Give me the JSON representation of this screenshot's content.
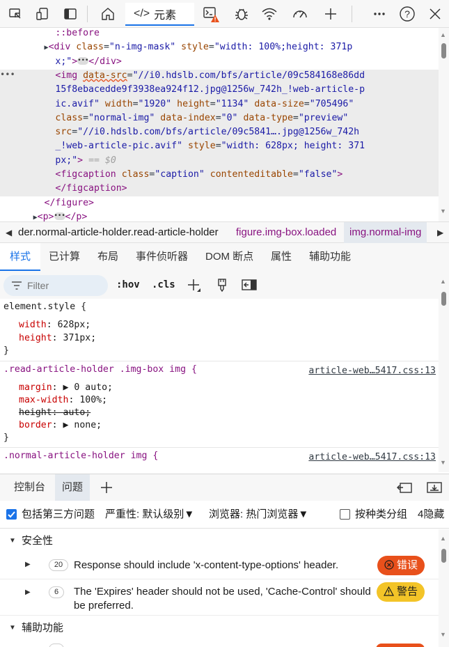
{
  "toolbar": {
    "elements_tab_label": "元素",
    "icons": [
      "inspect-icon",
      "device-emulation-icon",
      "dock-icon",
      "welcome-home-icon",
      "elements-code-icon",
      "console-icon",
      "bug-sources-icon",
      "wifi-network-icon",
      "performance-gauge-icon",
      "add-tool-icon",
      "more-icon",
      "help-icon",
      "close-icon"
    ],
    "warning_color": "#e8501b"
  },
  "dom": {
    "lines": [
      {
        "indent": "          ",
        "parts": [
          {
            "c": "tag",
            "t": "::before"
          }
        ]
      },
      {
        "indent": "         ",
        "caret": "▶",
        "parts": [
          {
            "c": "tag",
            "t": "<div "
          },
          {
            "c": "attr",
            "t": "class"
          },
          {
            "c": "plain",
            "t": "="
          },
          {
            "c": "val",
            "t": "\"n-img-mask\""
          },
          {
            "c": "plain",
            "t": " "
          },
          {
            "c": "attr",
            "t": "style"
          },
          {
            "c": "plain",
            "t": "="
          },
          {
            "c": "val",
            "t": "\"width: 100%;height: 371p"
          }
        ]
      },
      {
        "indent": "          ",
        "parts": [
          {
            "c": "val",
            "t": "x;\""
          },
          {
            "c": "tag",
            "t": ">"
          },
          {
            "c": "ell",
            "t": "•••"
          },
          {
            "c": "tag",
            "t": "</div>"
          }
        ]
      },
      {
        "indent": "          ",
        "parts": [
          {
            "c": "tag",
            "t": "<img "
          },
          {
            "c": "attr",
            "t": "data-src"
          },
          {
            "c": "plain",
            "t": "="
          },
          {
            "c": "val",
            "t": "\"//i0.hdslb.com/bfs/article/09c584168e86dd"
          }
        ]
      },
      {
        "indent": "          ",
        "parts": [
          {
            "c": "val",
            "t": "15f8ebacedde9f3938ea924f12.jpg@1256w_742h_!web-article-p"
          }
        ]
      },
      {
        "indent": "          ",
        "parts": [
          {
            "c": "val",
            "t": "ic.avif\""
          },
          {
            "c": "plain",
            "t": " "
          },
          {
            "c": "attr",
            "t": "width"
          },
          {
            "c": "plain",
            "t": "="
          },
          {
            "c": "val",
            "t": "\"1920\""
          },
          {
            "c": "plain",
            "t": " "
          },
          {
            "c": "attr",
            "t": "height"
          },
          {
            "c": "plain",
            "t": "="
          },
          {
            "c": "val",
            "t": "\"1134\""
          },
          {
            "c": "plain",
            "t": " "
          },
          {
            "c": "attr",
            "t": "data-size"
          },
          {
            "c": "plain",
            "t": "="
          },
          {
            "c": "val",
            "t": "\"705496\""
          }
        ]
      },
      {
        "indent": "          ",
        "parts": [
          {
            "c": "attr",
            "t": "class"
          },
          {
            "c": "plain",
            "t": "="
          },
          {
            "c": "val",
            "t": "\"normal-img\""
          },
          {
            "c": "plain",
            "t": " "
          },
          {
            "c": "attr",
            "t": "data-index"
          },
          {
            "c": "plain",
            "t": "="
          },
          {
            "c": "val",
            "t": "\"0\""
          },
          {
            "c": "plain",
            "t": " "
          },
          {
            "c": "attr",
            "t": "data-type"
          },
          {
            "c": "plain",
            "t": "="
          },
          {
            "c": "val",
            "t": "\"preview\""
          }
        ]
      },
      {
        "indent": "          ",
        "parts": [
          {
            "c": "attr",
            "t": "src"
          },
          {
            "c": "plain",
            "t": "="
          },
          {
            "c": "val",
            "t": "\"//i0.hdslb.com/bfs/article/09c5841….jpg@1256w_742h"
          }
        ]
      },
      {
        "indent": "          ",
        "parts": [
          {
            "c": "val",
            "t": "_!web-article-pic.avif\""
          },
          {
            "c": "plain",
            "t": " "
          },
          {
            "c": "attr",
            "t": "style"
          },
          {
            "c": "plain",
            "t": "="
          },
          {
            "c": "val",
            "t": "\"width: 628px; height: 371"
          }
        ]
      },
      {
        "indent": "          ",
        "parts": [
          {
            "c": "val",
            "t": "px;\""
          },
          {
            "c": "tag",
            "t": ">"
          },
          {
            "c": "dim",
            "t": " == $0"
          }
        ]
      },
      {
        "indent": "          ",
        "parts": [
          {
            "c": "tag",
            "t": "<figcaption "
          },
          {
            "c": "attr",
            "t": "class"
          },
          {
            "c": "plain",
            "t": "="
          },
          {
            "c": "val",
            "t": "\"caption\""
          },
          {
            "c": "plain",
            "t": " "
          },
          {
            "c": "attr",
            "t": "contenteditable"
          },
          {
            "c": "plain",
            "t": "="
          },
          {
            "c": "val",
            "t": "\"false\""
          },
          {
            "c": "tag",
            "t": ">"
          }
        ]
      },
      {
        "indent": "          ",
        "parts": [
          {
            "c": "tag",
            "t": "</figcaption>"
          }
        ]
      },
      {
        "indent": "        ",
        "parts": [
          {
            "c": "tag",
            "t": "</figure>"
          }
        ]
      },
      {
        "indent": "       ",
        "caret": "▶",
        "parts": [
          {
            "c": "tag",
            "t": "<p>"
          },
          {
            "c": "ell",
            "t": "•••"
          },
          {
            "c": "tag",
            "t": "</p>"
          }
        ]
      }
    ],
    "row_menu": "•••"
  },
  "breadcrumb": {
    "items": [
      "der.normal-article-holder.read-article-holder",
      "figure.img-box.loaded",
      "img.normal-img"
    ]
  },
  "panel_tabs": [
    "样式",
    "已计算",
    "布局",
    "事件侦听器",
    "DOM 断点",
    "属性",
    "辅助功能"
  ],
  "styles_toolbar": {
    "filter_placeholder": "Filter",
    "hov": ":hov",
    "cls": ".cls"
  },
  "styles": {
    "element_style": {
      "selector": "element.style {",
      "props": [
        {
          "name": "width",
          "value": "628px;"
        },
        {
          "name": "height",
          "value": "371px;"
        }
      ],
      "close": "}"
    },
    "rule1": {
      "selector": ".read-article-holder .img-box img {",
      "source": "article-web…5417.css:13",
      "props": [
        {
          "name": "margin",
          "value": "▶ 0 auto;",
          "struck": false
        },
        {
          "name": "max-width",
          "value": "100%;",
          "struck": false
        },
        {
          "name": "height",
          "value": "auto;",
          "struck": true
        },
        {
          "name": "border",
          "value": "▶ none;",
          "struck": false
        }
      ],
      "close": "}"
    },
    "rule2": {
      "selector": ".normal-article-holder img {",
      "source": "article-web…5417.css:13"
    }
  },
  "drawer": {
    "tabs": [
      "控制台",
      "问题"
    ],
    "active": "问题"
  },
  "issues_bar": {
    "include_third_party": "包括第三方问题",
    "severity": "严重性: 默认级别▼",
    "browser": "浏览器:  热门浏览器▼",
    "group_by_kind": "按种类分组",
    "hidden": "4隐藏"
  },
  "issues": {
    "security_label": "安全性",
    "accessibility_label": "辅助功能",
    "items": [
      {
        "count": "20",
        "text": "Response should include 'x-content-type-options' header.",
        "badge": "错误",
        "badge_icon": "error-circle-icon"
      },
      {
        "count": "6",
        "text": "The 'Expires' header should not be used, 'Cache-Control' should be preferred.",
        "badge": "警告",
        "badge_icon": "warning-triangle-icon"
      }
    ],
    "error_color": "#e8501b",
    "warning_color": "#f3c428"
  }
}
